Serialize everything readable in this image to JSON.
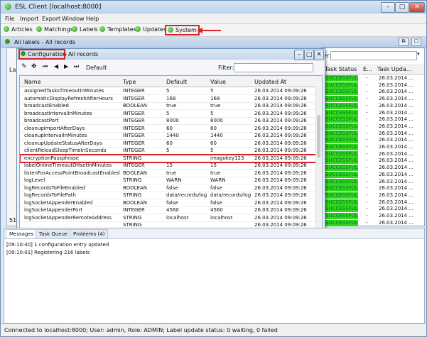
{
  "window": {
    "title": "ESL Client [localhost:8000]"
  },
  "menu": [
    "File",
    "Import",
    "Export",
    "Window",
    "Help"
  ],
  "toolbar": [
    "Articles",
    "Matchings",
    "Labels",
    "Templates",
    "Updates",
    "System"
  ],
  "panel": {
    "title": "All labels - All records"
  },
  "right_panel": {
    "filter_label": "er:",
    "headers": [
      "Task Status",
      "E...",
      "Task Upda..."
    ],
    "rows": [
      [
        "SUCCESSFUL",
        "-",
        "26.03.2014 ..."
      ],
      [
        "SUCCESSFUL",
        "-",
        "26.03.2014 ..."
      ],
      [
        "SUCCESSFUL",
        "-",
        "26.03.2014 ..."
      ],
      [
        "SUCCESSFUL",
        "-",
        "26.03.2014 ..."
      ],
      [
        "SUCCESSFUL",
        "-",
        "26.03.2014 ..."
      ],
      [
        "SUCCESSFUL",
        "-",
        "26.03.2014 ..."
      ],
      [
        "SUCCESSFUL",
        "-",
        "26.03.2014 ..."
      ],
      [
        "SUCCESSFUL",
        "-",
        "26.03.2014 ..."
      ],
      [
        "SUCCESSFUL",
        "-",
        "26.03.2014 ..."
      ],
      [
        "SUCCESSFUL",
        "-",
        "26.03.2014 ..."
      ],
      [
        "SUCCESSFUL",
        "-",
        "26.03.2014 ..."
      ],
      [
        "SUCCESSFUL",
        "-",
        "26.03.2014 ..."
      ],
      [
        "SUCCESSFUL",
        "-",
        "26.03.2014 ..."
      ],
      [
        "SUCCESSFUL",
        "-",
        "26.03.2014 ..."
      ],
      [
        "SUCCESSFUL",
        "-",
        "26.03.2014 ..."
      ],
      [
        "SUCCESSFUL",
        "-",
        "26.03.2014 ..."
      ],
      [
        "SUCCESSFUL",
        "-",
        "26.03.2014 ..."
      ],
      [
        "SUCCESSFUL",
        "-",
        "26.03.2014 ..."
      ],
      [
        "SUCCESSFUL",
        "-",
        "26.03.2014 ..."
      ],
      [
        "SUCCESSFUL",
        "-",
        "26.03.2014 ..."
      ],
      [
        "SUCCESSFUL",
        "-",
        "26.03.2014 ..."
      ],
      [
        "SUCCESSFUL",
        "-",
        "26.03.2014 ..."
      ]
    ]
  },
  "config": {
    "title": "Configuration",
    "subtitle": "All records",
    "default_label": "Default",
    "filter_label": "Filter:",
    "columns": [
      "Name",
      "Type",
      "Default",
      "Value",
      "Updated At"
    ],
    "rows": [
      [
        "assignedTasksTimeoutInMinutes",
        "INTEGER",
        "5",
        "5",
        "26.03.2014 09:09:26"
      ],
      [
        "automaticDisplayRefreshAfterHours",
        "INTEGER",
        "168",
        "168",
        "26.03.2014 09:09:26"
      ],
      [
        "broadcastEnabled",
        "BOOLEAN",
        "true",
        "true",
        "26.03.2014 09:09:26"
      ],
      [
        "broadcastIntervalInMinutes",
        "INTEGER",
        "5",
        "5",
        "26.03.2014 09:09:26"
      ],
      [
        "broadcastPort",
        "INTEGER",
        "8000",
        "8000",
        "26.03.2014 09:09:26"
      ],
      [
        "cleanupImportAfterDays",
        "INTEGER",
        "60",
        "60",
        "26.03.2014 09:09:26"
      ],
      [
        "cleanupIntervalInMinutes",
        "INTEGER",
        "1440",
        "1440",
        "26.03.2014 09:09:26"
      ],
      [
        "cleanupUpdateStatusAfterDays",
        "INTEGER",
        "60",
        "60",
        "26.03.2014 09:09:26"
      ],
      [
        "clientReloadSleepTimeInSeconds",
        "INTEGER",
        "5",
        "5",
        "26.03.2014 09:09:26"
      ],
      [
        "encryptionPassphrase",
        "STRING",
        "",
        "imagokey123",
        "26.03.2014 09:09:26"
      ],
      [
        "labelOnlineTimeoutOffsetInMinutes",
        "INTEGER",
        "15",
        "15",
        "26.03.2014 09:09:26"
      ],
      [
        "listenForAccessPointBroadcastEnabled",
        "BOOLEAN",
        "true",
        "true",
        "26.03.2014 09:09:26"
      ],
      [
        "logLevel",
        "STRING",
        "WARN",
        "WARN",
        "26.03.2014 09:09:26"
      ],
      [
        "logRecordsToFileEnabled",
        "BOOLEAN",
        "false",
        "false",
        "26.03.2014 09:09:26"
      ],
      [
        "logRecordsToFilePath",
        "STRING",
        "data/records/log",
        "data/records/log",
        "26.03.2014 09:09:26"
      ],
      [
        "logSocketAppenderEnabled",
        "BOOLEAN",
        "false",
        "false",
        "26.03.2014 09:09:26"
      ],
      [
        "logSocketAppenderPort",
        "INTEGER",
        "4560",
        "4560",
        "26.03.2014 09:09:26"
      ],
      [
        "logSocketAppenderRemoteAddress",
        "STRING",
        "localhost",
        "localhost",
        "26.03.2014 09:09:26"
      ],
      [
        "",
        "STRING",
        "",
        "",
        "26.03.2014 09:09:26"
      ]
    ]
  },
  "bottom": {
    "tabs": [
      "Messages",
      "Task Queue",
      "Problems (4)"
    ],
    "logs": [
      "[09:10:40] 1 configuration entry updated",
      "[09:10:01] Registering 216 labels"
    ]
  },
  "side_numbers": [
    "La",
    "51"
  ],
  "status": "Connected to localhost:8000; User: admin, Role: ADMIN; Label update status: 0 waiting, 0 failed"
}
